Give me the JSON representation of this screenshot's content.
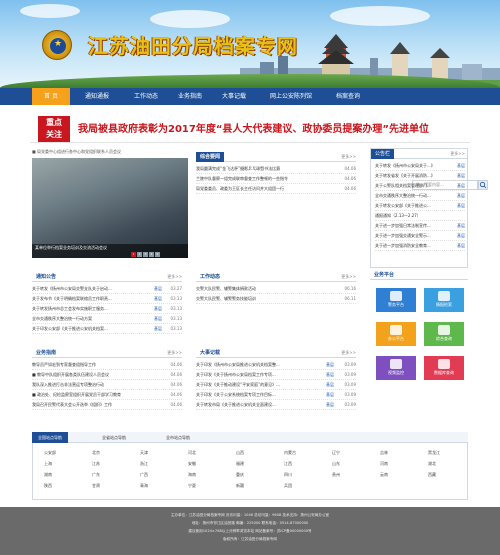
{
  "header": {
    "site_title": "江苏油田分局档案专网",
    "emblem_icon": "police-emblem-icon"
  },
  "nav": {
    "items": [
      "首 页",
      "通知通报",
      "工作动态",
      "业务指南",
      "大事记载",
      "网上公安陈列馆",
      "档案查询"
    ],
    "active_index": 0,
    "search_placeholder": "输入搜索内容..."
  },
  "headline": {
    "stamp_line1": "重点",
    "stamp_line2": "关注",
    "text": "我局被县政府表彰为2017年度“县人大代表建议、政协委员提案办理”先进单位"
  },
  "slideshow": {
    "marquee": "■ 局党委中心组进行各中心和党组织联系人员会议",
    "caption": "某单位举行档案业务培训及交流活动会议",
    "pages": [
      "1",
      "2",
      "3",
      "4",
      "5"
    ],
    "active_page": 0
  },
  "news": {
    "title": "综合要闻",
    "more": "更多>>",
    "rows": [
      {
        "text": "我局圆满完成“金飞达杯”摄影乒乓球暨书法比赛",
        "date": "04.06"
      },
      {
        "text": "兰陵中队督察一组完成联审督查工作整顿的一些指令",
        "date": "04.06"
      },
      {
        "text": "局党委委员、政委为王区长主任访问并大组团一行",
        "date": "04.06"
      }
    ]
  },
  "notice": {
    "title": "通知公告",
    "more": "更多>>",
    "rows": [
      {
        "text": "关于转发《扬州市公安局交警支队关于启动...",
        "src": "基层",
        "date": "03.27"
      },
      {
        "text": "关于发布节《关于明确档案联络员工作职责...",
        "src": "基层",
        "date": "03.13"
      },
      {
        "text": "关于转发扬州市总工会发布实施职工服务...",
        "src": "基层",
        "date": "03.13"
      },
      {
        "text": "全市交通秩序大整治统一行动方案",
        "src": "基层",
        "date": "03.13"
      },
      {
        "text": "关于印发公安部《关于推进公安机关档案...",
        "src": "基层",
        "date": "03.13"
      }
    ]
  },
  "work": {
    "title": "工作动态",
    "more": "更多>>",
    "rows": [
      {
        "text": "交警大队民警、辅警集体捐款活动",
        "date": "06.16"
      },
      {
        "text": "交警大队民警、辅警警务技能培训",
        "date": "06.11"
      }
    ]
  },
  "guide": {
    "title": "业务指南",
    "more": "更多>>",
    "rows": [
      {
        "text": "教导员严如宏到专家督查组指导工作",
        "date": "04.06"
      },
      {
        "text": "■ 教导中队组织开展各类队伍建设人员会议",
        "date": "04.06"
      },
      {
        "text": "我队深入推进打击非法营运专项整治行动",
        "date": "04.06"
      },
      {
        "text": "■ 政治处、纪检监察室组织开展党员干部学习教育",
        "date": "04.06"
      },
      {
        "text": "我局召开民警代表大会公开选举《组织》工作",
        "date": "04.06"
      }
    ]
  },
  "events": {
    "title": "大事记载",
    "more": "更多>>",
    "rows": [
      {
        "text": "关于印发《扬州市公安局推进公安机关档案整...",
        "src": "基层",
        "date": "03.09"
      },
      {
        "text": "关于印发《关于扬州市公安局档案工作专项...",
        "src": "基层",
        "date": "03.09"
      },
      {
        "text": "关于印发《关于推动建设“平安家庭”的意见》...",
        "src": "基层",
        "date": "03.09"
      },
      {
        "text": "关于印发《关于公安系统档案专项工作目标...",
        "src": "基层",
        "date": "03.09"
      },
      {
        "text": "关于转发市局《关于推进公安机关全面建设...",
        "src": "基层",
        "date": "03.09"
      }
    ]
  },
  "sidebar": {
    "notice_title": "公告栏",
    "more": "更多>>",
    "rows": [
      {
        "text": "关于转发《扬州市公安局关于...》",
        "src": "基层"
      },
      {
        "text": "关于转发省发《关于开展消防...》",
        "src": "基层"
      },
      {
        "text": "关于公警队相关档案管理部门...",
        "src": "基层"
      },
      {
        "text": "全市交通秩序大整治统一行动...",
        "src": "基层"
      },
      {
        "text": "关于转发公安部《关于推进公...",
        "src": "基层"
      },
      {
        "text": "通报通知（2.13—2.27）",
        "src": ""
      },
      {
        "text": "关于进一步加强日常法制宣传...",
        "src": "基层"
      },
      {
        "text": "关于进一步加强交通安全警示...",
        "src": "基层"
      },
      {
        "text": "关于进一步加强消防安全教育...",
        "src": "基层"
      }
    ],
    "services_title": "业务平台",
    "tiles": [
      {
        "label": "警务平台",
        "color": "#2f7fd4",
        "icon": "monitor-icon"
      },
      {
        "label": "情报检索",
        "color": "#3aa0e0",
        "icon": "cloud-icon"
      },
      {
        "label": "办公平台",
        "color": "#f3a21b",
        "icon": "document-icon"
      },
      {
        "label": "综合查询",
        "color": "#5eb84b",
        "icon": "chart-icon"
      },
      {
        "label": "视频监控",
        "color": "#7d4fbf",
        "icon": "play-icon"
      },
      {
        "label": "数据库查询",
        "color": "#e23b54",
        "icon": "bell-icon"
      }
    ]
  },
  "links": {
    "tabs": [
      "全国站点导航",
      "全省站点导航",
      "全市站点导航"
    ],
    "active_tab": 0,
    "items": [
      "公安部",
      "北京",
      "天津",
      "河北",
      "山西",
      "内蒙古",
      "辽宁",
      "吉林",
      "黑龙江",
      "上海",
      "江苏",
      "浙江",
      "安徽",
      "福建",
      "江西",
      "山东",
      "河南",
      "湖北",
      "湖南",
      "广东",
      "广西",
      "海南",
      "重庆",
      "四川",
      "贵州",
      "云南",
      "西藏",
      "陕西",
      "甘肃",
      "青海",
      "宁夏",
      "新疆",
      "兵团"
    ]
  },
  "footer": {
    "line1": "主办单位：江苏油田分局档案专网  页访问量：1046  总访问量：9608  技术支持：扬州公安局办公室",
    "line2": "地址：扬州市邗江区油田路  邮编：225000  联系电话：0514-87000000",
    "line3": "建议使用1024×768以上分辨率浏览本站  网站备案号：苏ICP备00000000号",
    "line4": "版权所有：江苏油田分局档案专网"
  }
}
